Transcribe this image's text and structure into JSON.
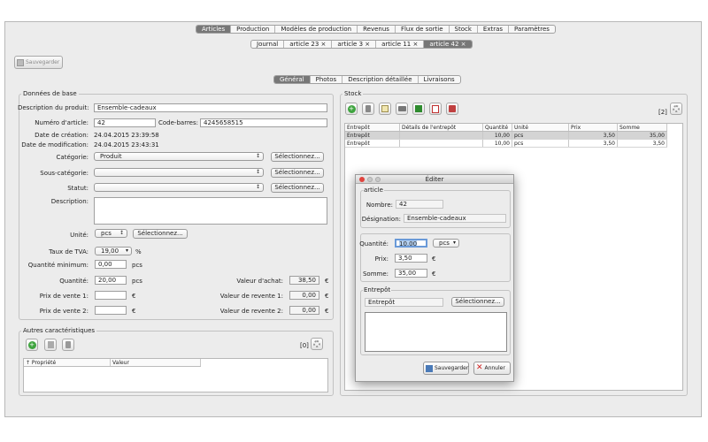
{
  "main_tabs": [
    {
      "label": "Articles",
      "active": true
    },
    {
      "label": "Production"
    },
    {
      "label": "Modèles de production"
    },
    {
      "label": "Revenus"
    },
    {
      "label": "Flux de sortie"
    },
    {
      "label": "Stock"
    },
    {
      "label": "Extras"
    },
    {
      "label": "Paramètres"
    }
  ],
  "doc_tabs": [
    {
      "label": "Journal"
    },
    {
      "label": "article 23 ×"
    },
    {
      "label": "article 3 ×"
    },
    {
      "label": "article 11 ×"
    },
    {
      "label": "article 42 ×",
      "active": true
    }
  ],
  "save_label": "Sauvegarder",
  "sub_tabs": [
    {
      "label": "Général",
      "active": true
    },
    {
      "label": "Photos"
    },
    {
      "label": "Description détaillée"
    },
    {
      "label": "Livraisons"
    }
  ],
  "base": {
    "title": "Données de base",
    "desc_label": "Description du produit:",
    "desc_value": "Ensemble-cadeaux",
    "num_label": "Numéro d'article:",
    "num_value": "42",
    "barcode_label": "Code-barres:",
    "barcode_value": "4245658515",
    "created_label": "Date de création:",
    "created_value": "24.04.2015 23:39:58",
    "modified_label": "Date de modification:",
    "modified_value": "24.04.2015 23:43:31",
    "cat_label": "Catégorie:",
    "cat_value": "Produit",
    "subcat_label": "Sous-catégorie:",
    "status_label": "Statut:",
    "description_label": "Description:",
    "select_btn": "Sélectionnez...",
    "unit_label": "Unité:",
    "unit_value": "pcs",
    "tva_label": "Taux de TVA:",
    "tva_value": "19,00",
    "tva_unit": "%",
    "qmin_label": "Quantité minimum:",
    "qmin_value": "0,00",
    "pcs": "pcs",
    "qty_label": "Quantité:",
    "qty_value": "20,00",
    "p1_label": "Prix de vente 1:",
    "p2_label": "Prix de vente 2:",
    "eur": "€",
    "va_label": "Valeur d'achat:",
    "va_value": "38,50",
    "vr1_label": "Valeur de revente 1:",
    "vr1_value": "0,00",
    "vr2_label": "Valeur de revente 2:",
    "vr2_value": "0,00"
  },
  "other": {
    "title": "Autres caractéristiques",
    "count": "[0]",
    "col1": "↑ Propriété",
    "col2": "Valeur"
  },
  "stock": {
    "title": "Stock",
    "count": "[2]",
    "headers": [
      "Entrepôt",
      "Détails de l'entrepôt",
      "Quantité",
      "Unité",
      "Prix",
      "Somme"
    ],
    "rows": [
      [
        "Entrepôt",
        "",
        "10,00",
        "pcs",
        "3,50",
        "35,00"
      ],
      [
        "Entrepôt",
        "",
        "10,00",
        "pcs",
        "3,50",
        "3,50"
      ]
    ]
  },
  "dialog": {
    "title": "Éditer",
    "article_group": "article",
    "nombre_label": "Nombre:",
    "nombre_value": "42",
    "design_label": "Désignation:",
    "design_value": "Ensemble-cadeaux",
    "qty_label": "Quantité:",
    "qty_value": "10,00",
    "unit": "pcs",
    "prix_label": "Prix:",
    "prix_value": "3,50",
    "somme_label": "Somme:",
    "somme_value": "35,00",
    "eur": "€",
    "ent_group": "Entrepôt",
    "ent_value": "Entrepôt",
    "select_btn": "Sélectionnez...",
    "save": "Sauvegarder",
    "cancel": "Annuler"
  }
}
